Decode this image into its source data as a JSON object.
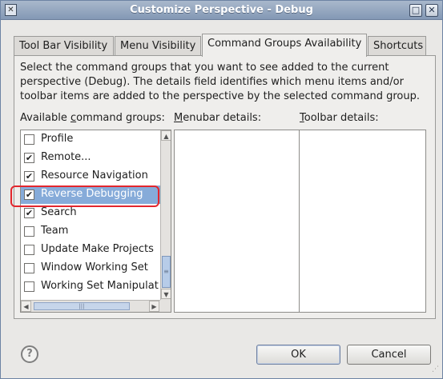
{
  "window": {
    "title": "Customize Perspective - Debug",
    "maximize_glyph": "□",
    "close_glyph": "✕"
  },
  "tabs": [
    {
      "label": "Tool Bar Visibility",
      "active": false
    },
    {
      "label": "Menu Visibility",
      "active": false
    },
    {
      "label": "Command Groups Availability",
      "active": true
    },
    {
      "label": "Shortcuts",
      "active": false
    }
  ],
  "panel": {
    "description": "Select the command groups that you want to see added to the current perspective (Debug).  The details field identifies which menu items and/or toolbar items are added to the perspective by the selected command group.",
    "available_label_pre": "Available ",
    "available_label_mnemonic": "c",
    "available_label_post": "ommand groups:",
    "menubar_label_mnemonic": "M",
    "menubar_label_post": "enubar details:",
    "toolbar_label_mnemonic": "T",
    "toolbar_label_post": "oolbar details:"
  },
  "command_groups": [
    {
      "label": "Profile",
      "checked": false,
      "selected": false
    },
    {
      "label": "Remote...",
      "checked": true,
      "selected": false
    },
    {
      "label": "Resource Navigation",
      "checked": true,
      "selected": false
    },
    {
      "label": "Reverse Debugging",
      "checked": true,
      "selected": true
    },
    {
      "label": "Search",
      "checked": true,
      "selected": false
    },
    {
      "label": "Team",
      "checked": false,
      "selected": false
    },
    {
      "label": "Update Make Projects",
      "checked": false,
      "selected": false
    },
    {
      "label": "Window Working Set",
      "checked": false,
      "selected": false
    },
    {
      "label": "Working Set Manipulat",
      "checked": false,
      "selected": false
    }
  ],
  "scroll_glyphs": {
    "up": "▲",
    "down": "▼",
    "left": "◀",
    "right": "▶",
    "grip_v": "≡",
    "grip_h": "|||"
  },
  "buttons": {
    "help": "?",
    "ok": "OK",
    "cancel": "Cancel"
  },
  "colors": {
    "selection": "#86abd9",
    "highlight_ring": "#e3262d",
    "titlebar": "#8ea2bd"
  }
}
